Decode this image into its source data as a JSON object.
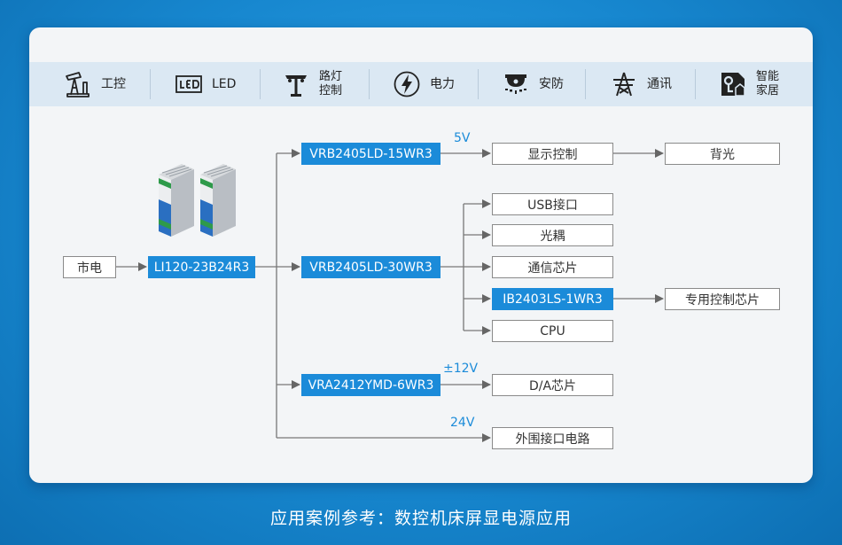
{
  "industries": [
    {
      "icon": "oil-pump-icon",
      "label": "工控"
    },
    {
      "icon": "led-icon",
      "label": "LED"
    },
    {
      "icon": "street-lamp-icon",
      "label": "路灯\n控制"
    },
    {
      "icon": "power-bolt-icon",
      "label": "电力"
    },
    {
      "icon": "security-camera-icon",
      "label": "安防"
    },
    {
      "icon": "transmission-tower-icon",
      "label": "通讯"
    },
    {
      "icon": "smart-home-icon",
      "label": "智能\n家居"
    }
  ],
  "diagram": {
    "mains": "市电",
    "acdc": "LI120-23B24R3",
    "dcdc_1": "VRB2405LD-15WR3",
    "dcdc_2": "VRB2405LD-30WR3",
    "dcdc_3": "VRA2412YMD-6WR3",
    "voltage_5v": "5V",
    "voltage_pm12v": "±12V",
    "voltage_24v": "24V",
    "display_control": "显示控制",
    "backlight": "背光",
    "usb": "USB接口",
    "optocoupler": "光耦",
    "comm_chip": "通信芯片",
    "isolator": "IB2403LS-1WR3",
    "dedicated_chip": "专用控制芯片",
    "cpu": "CPU",
    "da_chip": "D/A芯片",
    "ext_circuit": "外围接口电路"
  },
  "caption": "应用案例参考：数控机床屏显电源应用",
  "colors": {
    "accent": "#1b8bd9",
    "background": "#1787cf",
    "card": "#f3f5f7",
    "bar": "#dbe8f3"
  }
}
